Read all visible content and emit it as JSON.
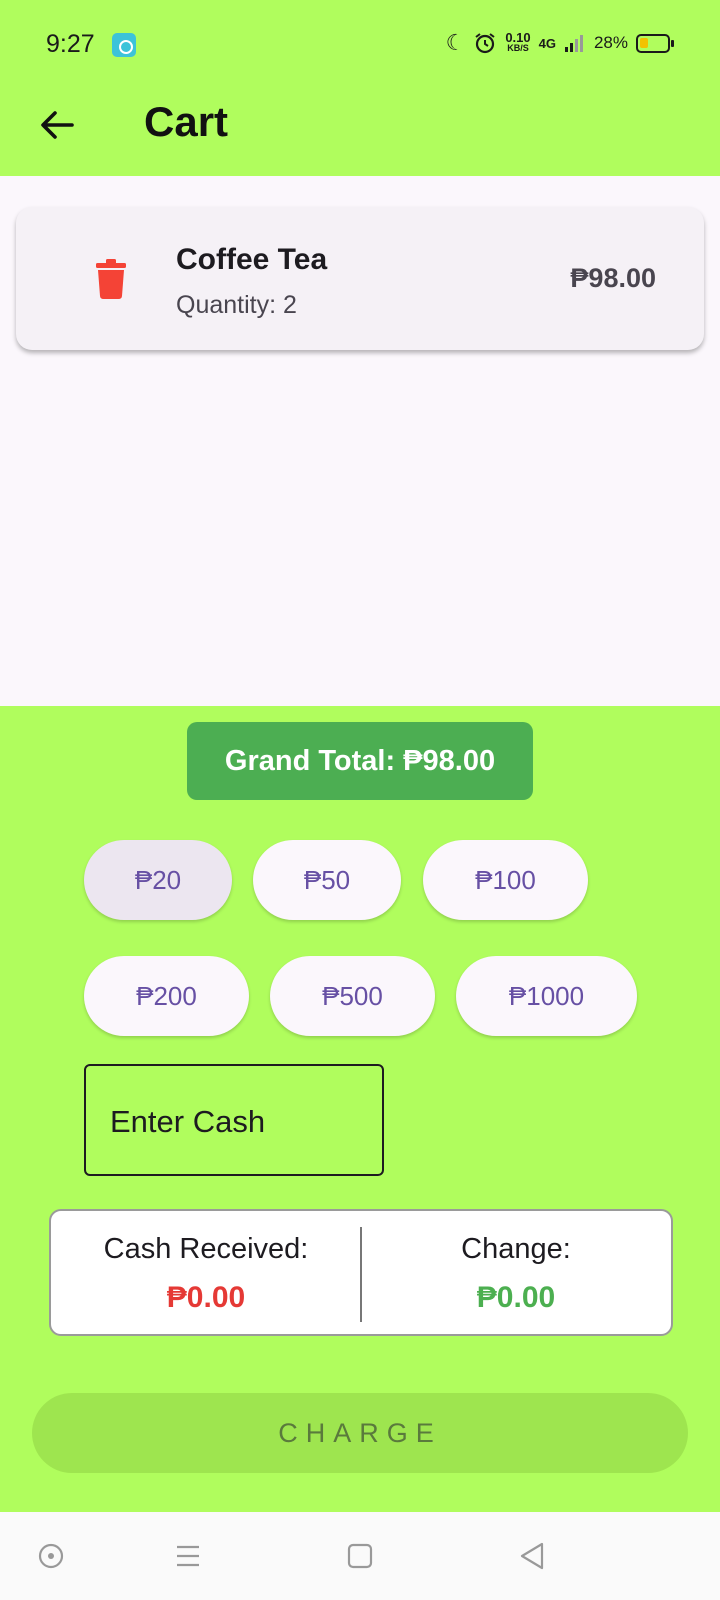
{
  "status_bar": {
    "time": "9:27",
    "net_speed_value": "0.10",
    "net_speed_unit": "KB/S",
    "network": "4G",
    "battery_percent": "28%",
    "icons": [
      "app-notification-icon",
      "moon-icon",
      "alarm-icon",
      "signal-icon",
      "battery-icon"
    ]
  },
  "app_bar": {
    "title": "Cart",
    "back_icon": "arrow-left-icon"
  },
  "cart_items": [
    {
      "name": "Coffee Tea",
      "quantity_text": "Quantity: 2",
      "price": "₱98.00",
      "delete_icon": "trash-icon"
    }
  ],
  "grand_total_text": "Grand Total: ₱98.00",
  "cash_options": [
    "₱20",
    "₱50",
    "₱100",
    "₱200",
    "₱500",
    "₱1000"
  ],
  "selected_cash_option": "₱20",
  "cash_input": {
    "placeholder": "Enter Cash",
    "value": ""
  },
  "summary": {
    "cash_received_label": "Cash Received:",
    "cash_received_value": "₱0.00",
    "change_label": "Change:",
    "change_value": "₱0.00"
  },
  "charge_button_label": "CHARGE",
  "colors": {
    "background": "#b0fd5d",
    "grand_total_bg": "#4cae52",
    "delete": "#f44336",
    "cash_received": "#e53935",
    "change": "#4caf50",
    "chip_text": "#6750a4"
  },
  "system_nav": [
    "accessibility-icon",
    "menu-icon",
    "home-icon",
    "back-triangle-icon"
  ]
}
